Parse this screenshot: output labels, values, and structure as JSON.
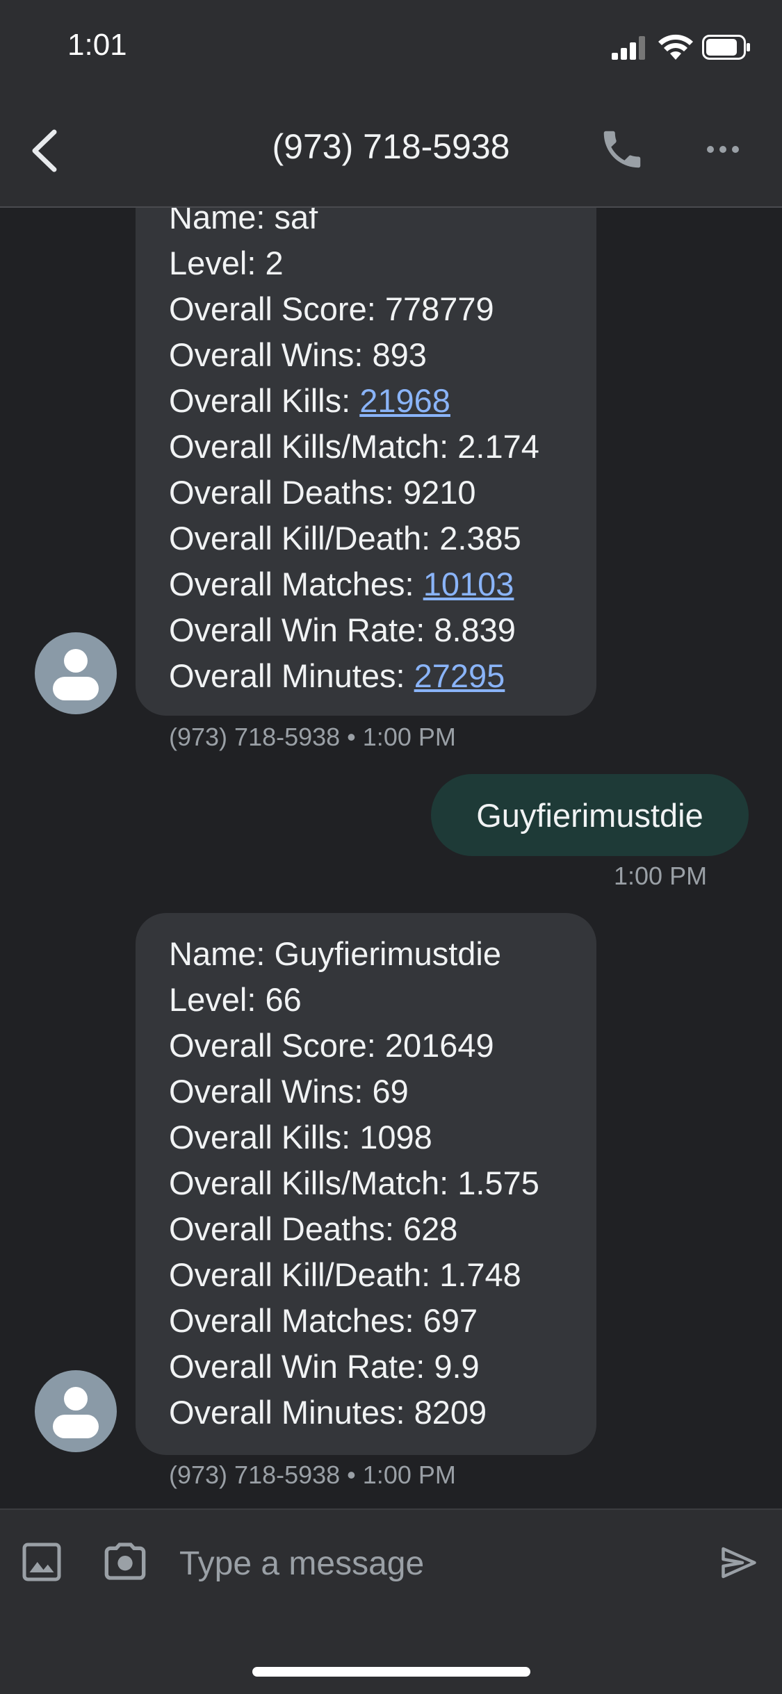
{
  "status_bar": {
    "time": "1:01"
  },
  "app_bar": {
    "title": "(973) 718-5938"
  },
  "messages": [
    {
      "direction": "incoming",
      "lines": [
        {
          "label": "Name: ",
          "value": "saf",
          "link": false
        },
        {
          "label": "Level: ",
          "value": "2",
          "link": false
        },
        {
          "label": "Overall Score: ",
          "value": "778779",
          "link": false
        },
        {
          "label": "Overall Wins: ",
          "value": "893",
          "link": false
        },
        {
          "label": "Overall Kills: ",
          "value": "21968",
          "link": true
        },
        {
          "label": "Overall Kills/Match: ",
          "value": "2.174",
          "link": false
        },
        {
          "label": "Overall Deaths: ",
          "value": "9210",
          "link": false
        },
        {
          "label": "Overall Kill/Death: ",
          "value": "2.385",
          "link": false
        },
        {
          "label": "Overall Matches: ",
          "value": "10103",
          "link": true
        },
        {
          "label": "Overall Win Rate: ",
          "value": "8.839",
          "link": false
        },
        {
          "label": "Overall Minutes: ",
          "value": "27295",
          "link": true
        }
      ],
      "meta": "(973) 718-5938 • 1:00 PM"
    },
    {
      "direction": "outgoing",
      "text": "Guyfierimustdie",
      "meta": "1:00 PM"
    },
    {
      "direction": "incoming",
      "lines": [
        {
          "label": "Name: ",
          "value": "Guyfierimustdie",
          "link": false
        },
        {
          "label": "Level: ",
          "value": "66",
          "link": false
        },
        {
          "label": "Overall Score: ",
          "value": "201649",
          "link": false
        },
        {
          "label": "Overall Wins: ",
          "value": "69",
          "link": false
        },
        {
          "label": "Overall Kills: ",
          "value": "1098",
          "link": false
        },
        {
          "label": "Overall Kills/Match: ",
          "value": "1.575",
          "link": false
        },
        {
          "label": "Overall Deaths: ",
          "value": "628",
          "link": false
        },
        {
          "label": "Overall Kill/Death: ",
          "value": "1.748",
          "link": false
        },
        {
          "label": "Overall Matches: ",
          "value": "697",
          "link": false
        },
        {
          "label": "Overall Win Rate: ",
          "value": "9.9",
          "link": false
        },
        {
          "label": "Overall Minutes: ",
          "value": "8209",
          "link": false
        }
      ],
      "meta": "(973) 718-5938 • 1:00 PM"
    }
  ],
  "composer": {
    "placeholder": "Type a message"
  },
  "icons": {
    "back": "chevron-left-icon",
    "call": "phone-icon",
    "more": "more-horizontal-icon",
    "gallery": "image-icon",
    "camera": "camera-icon",
    "send": "send-icon",
    "avatar": "person-icon"
  },
  "colors": {
    "background": "#202124",
    "header": "#2d2e31",
    "incoming_bubble": "#34363a",
    "outgoing_bubble": "#1e3a37",
    "link": "#8ab4f8"
  }
}
